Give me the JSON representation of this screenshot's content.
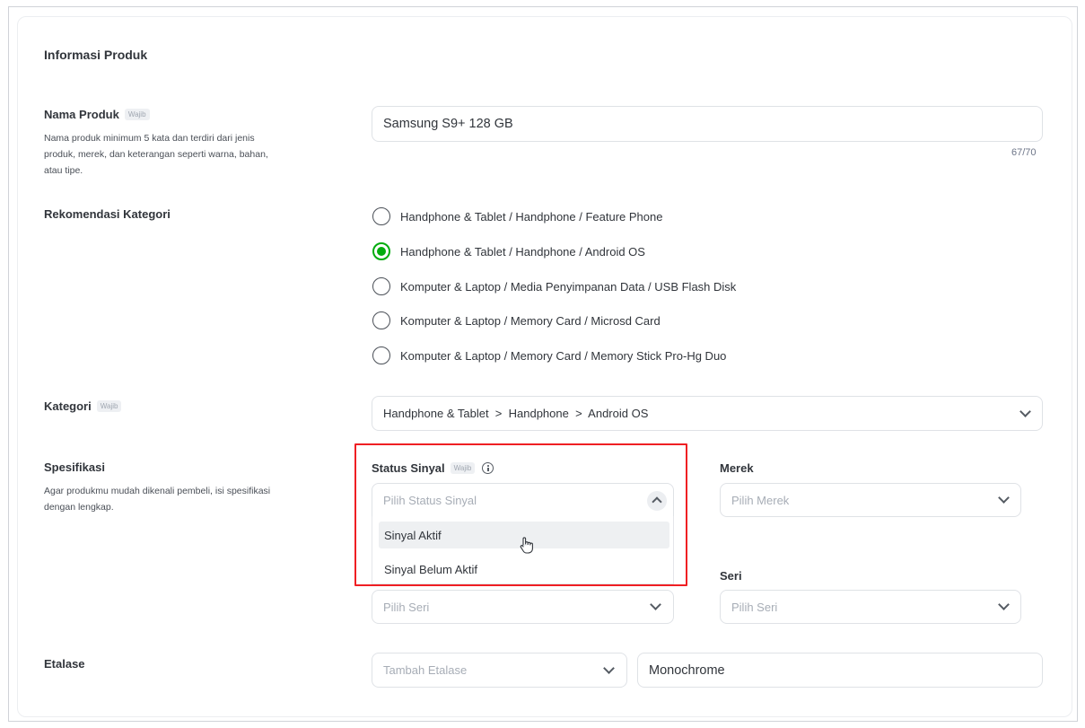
{
  "form": {
    "section_title": "Informasi Produk",
    "required_badge": "Wajib",
    "product_name": {
      "label": "Nama Produk",
      "help": "Nama produk minimum 5 kata dan terdiri dari jenis produk, merek, dan keterangan seperti warna, bahan, atau tipe.",
      "value": "Samsung S9+ 128 GB",
      "counter": "67/70"
    },
    "category_recommendation": {
      "label": "Rekomendasi Kategori",
      "options": [
        "Handphone & Tablet / Handphone / Feature Phone",
        "Handphone & Tablet / Handphone / Android OS",
        "Komputer & Laptop / Media Penyimpanan Data / USB  Flash Disk",
        "Komputer & Laptop / Memory Card / Microsd Card",
        "Komputer & Laptop / Memory Card / Memory Stick Pro-Hg Duo"
      ],
      "selected": "Handphone & Tablet / Handphone / Android OS"
    },
    "category": {
      "label": "Kategori",
      "value": "Handphone & Tablet  >  Handphone  >  Android OS"
    },
    "specification": {
      "label": "Spesifikasi",
      "help": "Agar produkmu mudah dikenali pembeli, isi spesifikasi dengan lengkap.",
      "signal_status": {
        "label": "Status Sinyal",
        "placeholder": "Pilih Status Sinyal",
        "options": [
          "Sinyal Aktif",
          "Sinyal Belum Aktif"
        ],
        "hovered": "Sinyal Aktif"
      },
      "brand": {
        "label": "Merek",
        "placeholder": "Pilih Merek"
      },
      "series_left": {
        "placeholder": "Pilih Seri"
      },
      "series_right": {
        "label": "Seri",
        "placeholder": "Pilih Seri"
      }
    },
    "showcase": {
      "label": "Etalase",
      "placeholder": "Tambah Etalase",
      "value": "Monochrome"
    }
  },
  "colors": {
    "accent_green": "#03ac0e",
    "highlight_red": "#ef1f23"
  }
}
